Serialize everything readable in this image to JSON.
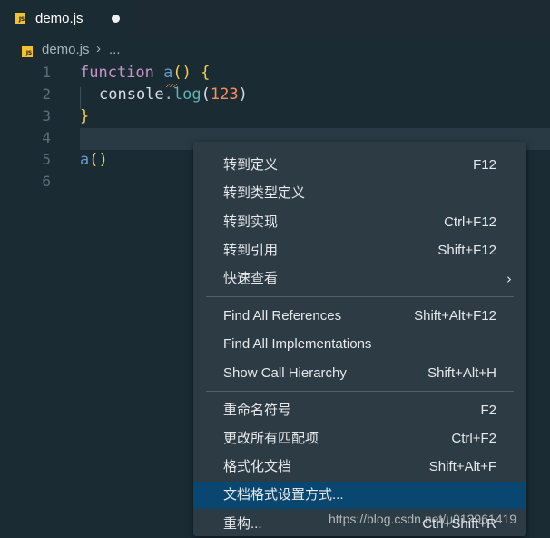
{
  "tab": {
    "label": "demo.js",
    "icon": "js-file-icon",
    "badge": "JS"
  },
  "breadcrumb": {
    "file": "demo.js",
    "separator": "›",
    "more": "..."
  },
  "editor": {
    "line_numbers": [
      "1",
      "2",
      "3",
      "4",
      "5",
      "6"
    ],
    "code": {
      "l1_kw": "function",
      "l1_fn": "a",
      "l1_paren": "()",
      "l1_brace": "{",
      "l2_obj": "console",
      "l2_dot": ".",
      "l2_method": "log",
      "l2_open": "(",
      "l2_num": "123",
      "l2_close": ")",
      "l3_brace": "}",
      "l5_fn": "a",
      "l5_paren": "()"
    }
  },
  "context_menu": {
    "groups": [
      [
        {
          "label": "转到定义",
          "key": "F12"
        },
        {
          "label": "转到类型定义",
          "key": ""
        },
        {
          "label": "转到实现",
          "key": "Ctrl+F12"
        },
        {
          "label": "转到引用",
          "key": "Shift+F12"
        },
        {
          "label": "快速查看",
          "key": "",
          "submenu": "›"
        }
      ],
      [
        {
          "label": "Find All References",
          "key": "Shift+Alt+F12"
        },
        {
          "label": "Find All Implementations",
          "key": ""
        },
        {
          "label": "Show Call Hierarchy",
          "key": "Shift+Alt+H"
        }
      ],
      [
        {
          "label": "重命名符号",
          "key": "F2"
        },
        {
          "label": "更改所有匹配项",
          "key": "Ctrl+F2"
        },
        {
          "label": "格式化文档",
          "key": "Shift+Alt+F"
        },
        {
          "label": "文档格式设置方式...",
          "key": "",
          "active": true
        },
        {
          "label": "重构...",
          "key": "Ctrl+Shift+R"
        }
      ]
    ]
  },
  "watermark": "https://blog.csdn.net/u012961419",
  "colors": {
    "background": "#1b2b34",
    "menu_bg": "#2d3b44",
    "menu_active": "#094771",
    "keyword": "#c695c6",
    "function": "#6699cc",
    "bracket": "#f5d24a",
    "number": "#f99157"
  }
}
